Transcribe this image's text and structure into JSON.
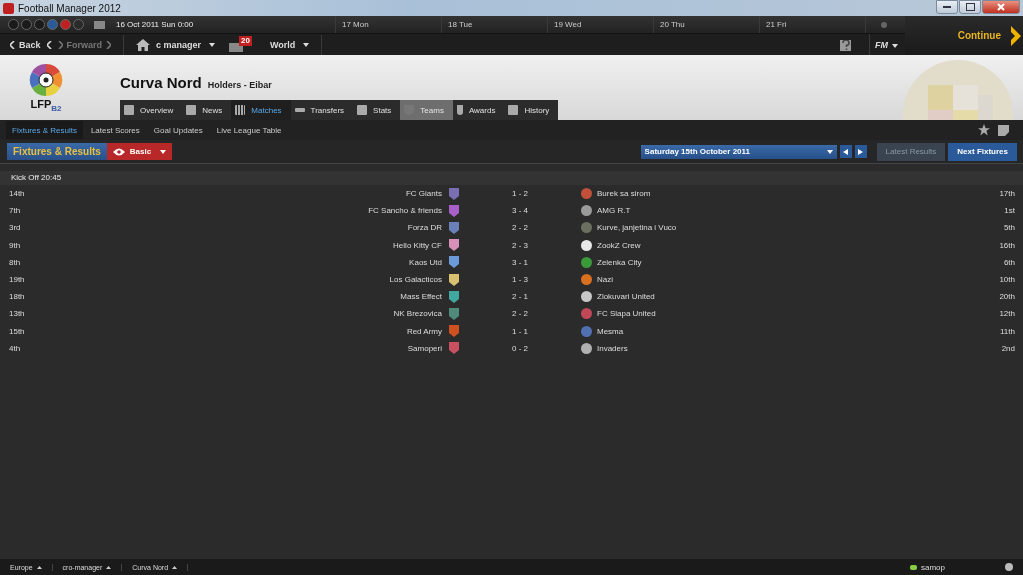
{
  "window": {
    "title": "Football Manager 2012"
  },
  "calendar": {
    "current": "16 Oct 2011 Sun 0:00",
    "days": [
      "17 Mon",
      "18 Tue",
      "19 Wed",
      "20 Thu",
      "21 Fri"
    ]
  },
  "nav": {
    "back": "Back",
    "forward": "Forward",
    "forward_disabled": true,
    "manager": "c manager",
    "inbox_count": "20",
    "world": "World",
    "fm_menu": "FM",
    "continue": "Continue"
  },
  "header": {
    "logo": "LFP$_{B2}$",
    "title": "Curva Nord",
    "subtitle": "Holders - Eibar"
  },
  "tabs": [
    {
      "label": "Overview",
      "selected": false,
      "disabled": false
    },
    {
      "label": "News",
      "selected": false,
      "disabled": false
    },
    {
      "label": "Matches",
      "selected": true,
      "disabled": false
    },
    {
      "label": "Transfers",
      "selected": false,
      "disabled": false
    },
    {
      "label": "Stats",
      "selected": false,
      "disabled": false
    },
    {
      "label": "Teams",
      "selected": false,
      "disabled": true
    },
    {
      "label": "Awards",
      "selected": false,
      "disabled": false
    },
    {
      "label": "History",
      "selected": false,
      "disabled": false
    }
  ],
  "subnav": [
    {
      "label": "Fixtures & Results",
      "selected": true
    },
    {
      "label": "Latest Scores",
      "selected": false
    },
    {
      "label": "Goal Updates",
      "selected": false
    },
    {
      "label": "Live League Table",
      "selected": false
    }
  ],
  "toolbar": {
    "title": "Fixtures & Results",
    "view": "Basic",
    "date": "Saturday 15th October 2011",
    "buttons": [
      {
        "label": "Latest Results",
        "selected": false
      },
      {
        "label": "Next Fixtures",
        "selected": true
      }
    ]
  },
  "group": "Kick Off 20:45",
  "matches": [
    {
      "home": {
        "position": "14th",
        "name": "FC Giants",
        "color": "#7a6fb0"
      },
      "score": "1 - 2",
      "away": {
        "name": "Burek sa sirom",
        "position": "17th",
        "color": "#c0503a"
      }
    },
    {
      "home": {
        "position": "7th",
        "name": "FC Sancho & friends",
        "color": "#a860c8"
      },
      "score": "3 - 4",
      "away": {
        "name": "AMG R.T",
        "position": "1st",
        "color": "#9a9a9a"
      }
    },
    {
      "home": {
        "position": "3rd",
        "name": "Forza DR",
        "color": "#6a80b8"
      },
      "score": "2 - 2",
      "away": {
        "name": "Kurve, janjetina i Vuco",
        "position": "5th",
        "color": "#6a7060"
      }
    },
    {
      "home": {
        "position": "9th",
        "name": "Hello Kitty CF",
        "color": "#d890b8"
      },
      "score": "2 - 3",
      "away": {
        "name": "ZookZ Crew",
        "position": "16th",
        "color": "#e8e8e8"
      }
    },
    {
      "home": {
        "position": "8th",
        "name": "Kaos Utd",
        "color": "#6a9ad8"
      },
      "score": "3 - 1",
      "away": {
        "name": "Zelenka City",
        "position": "6th",
        "color": "#3a9a3a"
      }
    },
    {
      "home": {
        "position": "19th",
        "name": "Los Galacticos",
        "color": "#d8c070"
      },
      "score": "1 - 3",
      "away": {
        "name": "Nazi",
        "position": "10th",
        "color": "#d87020"
      }
    },
    {
      "home": {
        "position": "18th",
        "name": "Mass Effect",
        "color": "#40a8a0"
      },
      "score": "2 - 1",
      "away": {
        "name": "Zlokuvari United",
        "position": "20th",
        "color": "#c8c8c8"
      }
    },
    {
      "home": {
        "position": "13th",
        "name": "NK Brezovica",
        "color": "#508a7a"
      },
      "score": "2 - 2",
      "away": {
        "name": "FC Slapa United",
        "position": "12th",
        "color": "#c04858"
      }
    },
    {
      "home": {
        "position": "15th",
        "name": "Red Army",
        "color": "#d05020"
      },
      "score": "1 - 1",
      "away": {
        "name": "Mesma",
        "position": "11th",
        "color": "#5070b0"
      }
    },
    {
      "home": {
        "position": "4th",
        "name": "Samoperi",
        "color": "#c85060"
      },
      "score": "0 - 2",
      "away": {
        "name": "Invaders",
        "position": "2nd",
        "color": "#b0b0b0"
      }
    }
  ],
  "status_bar": {
    "crumbs": [
      "Europe",
      "cro-manager",
      "Curva Nord"
    ],
    "user": "samop"
  }
}
